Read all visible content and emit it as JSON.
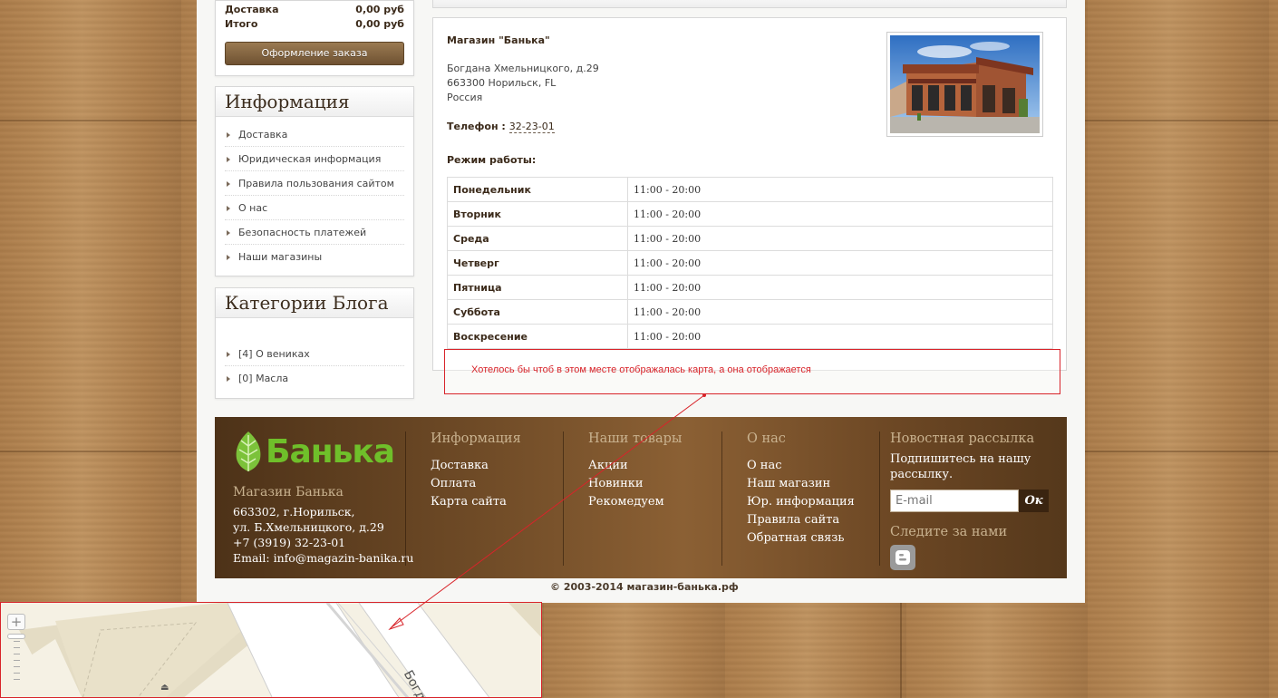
{
  "cart": {
    "rows": [
      {
        "label": "Доставка",
        "value": "0,00 руб"
      },
      {
        "label": "Итого",
        "value": "0,00 руб"
      }
    ],
    "checkout_label": "Оформление заказа"
  },
  "info_box": {
    "title": "Информация",
    "items": [
      "Доставка",
      "Юридическая информация",
      "Правила пользования сайтом",
      "О нас",
      "Безопасность платежей",
      "Наши магазины"
    ]
  },
  "blog_box": {
    "title": "Категории Блога",
    "items": [
      "[4] О вениках",
      "[0] Масла"
    ]
  },
  "store": {
    "name": "Магазин \"Банька\"",
    "address_lines": [
      "Богдана Хмельницкого, д.29",
      "663300 Норильск, FL",
      "Россия"
    ],
    "phone_label": "Телефон :",
    "phone": "32-23-01",
    "hours_label": "Режим работы:",
    "hours": [
      {
        "day": "Понедельник",
        "time": "11:00 - 20:00"
      },
      {
        "day": "Вторник",
        "time": "11:00 - 20:00"
      },
      {
        "day": "Среда",
        "time": "11:00 - 20:00"
      },
      {
        "day": "Четверг",
        "time": "11:00 - 20:00"
      },
      {
        "day": "Пятница",
        "time": "11:00 - 20:00"
      },
      {
        "day": "Суббота",
        "time": "11:00 - 20:00"
      },
      {
        "day": "Воскресение",
        "time": "11:00 - 20:00"
      }
    ]
  },
  "annotation": {
    "text": "Хотелось бы чтоб в этом месте отображалась карта, а она отображается",
    "color": "#d8242a"
  },
  "footer": {
    "logo_text": "Банька",
    "shop_title": "Магазин Банька",
    "contacts": [
      "663302, г.Норильск,",
      "ул. Б.Хмельницкого, д.29",
      "+7 (3919) 32-23-01",
      "Email: info@magazin-banika.ru"
    ],
    "columns": [
      {
        "title": "Информация",
        "links": [
          "Доставка",
          "Оплата",
          "Карта сайта"
        ]
      },
      {
        "title": "Наши товары",
        "links": [
          "Акции",
          "Новинки",
          "Рекомедуем"
        ]
      },
      {
        "title": "О нас",
        "links": [
          "О нас",
          "Наш магазин",
          "Юр. информация",
          "Правила сайта",
          "Обратная связь"
        ]
      }
    ],
    "newsletter": {
      "title": "Новостная рассылка",
      "subtitle": "Подпишитесь на нашу рассылку.",
      "email_placeholder": "E-mail",
      "ok_label": "Ок"
    },
    "follow_title": "Следите за нами",
    "copyright": "© 2003-2014 магазин-банька.рф"
  },
  "map": {
    "street_label": "Богдан",
    "zoom_plus": "+"
  }
}
